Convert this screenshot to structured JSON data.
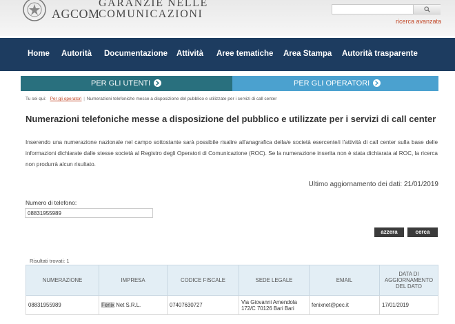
{
  "header": {
    "brand_line1": "GARANZIE NELLE",
    "brand_line2": "COMUNICAZIONI",
    "brand_acronym": "AGCOM",
    "search": {
      "placeholder": "",
      "button_icon": "search-icon"
    },
    "advanced_search": "ricerca avanzata"
  },
  "nav": {
    "items": [
      {
        "label": "Home"
      },
      {
        "label": "Autorità"
      },
      {
        "label": "Documentazione"
      },
      {
        "label": "Attività"
      },
      {
        "label": "Aree tematiche"
      },
      {
        "label": "Area Stampa"
      },
      {
        "label": "Autorità trasparente"
      }
    ]
  },
  "audience": {
    "users": "PER GLI UTENTI",
    "operators": "PER GLI OPERATORI"
  },
  "breadcrumb": {
    "prefix": "Tu sei qui:",
    "link": "Per gli operatori",
    "current": "Numerazioni telefoniche messe a disposizione del pubblico e utilizzate per i servizi di call center"
  },
  "page": {
    "title": "Numerazioni telefoniche messe a disposizione del pubblico e utilizzate per i servizi di call center",
    "description": "Inserendo una numerazione nazionale nel campo sottostante sarà possibile risalire all'anagrafica della/e società esercente/i l'attività di call center sulla base delle informazioni dichiarate dalle stesse società al Registro degli Operatori di Comunicazione (ROC). Se la numerazione inserita non è stata dichiarata al ROC, la ricerca non produrrà alcun risultato.",
    "last_update": "Ultimo aggiornamento dei dati: 21/01/2019"
  },
  "form": {
    "phone_label": "Numero di telefono:",
    "phone_value": "08831955989",
    "reset_label": "azzera",
    "search_label": "cerca"
  },
  "results": {
    "count_text": "Risultati trovati: 1",
    "columns": [
      "NUMERAZIONE",
      "IMPRESA",
      "CODICE FISCALE",
      "SEDE LEGALE",
      "EMAIL",
      "DATA DI AGGIORNAMENTO DEL DATO"
    ],
    "rows": [
      {
        "numerazione": "08831955989",
        "impresa_highlight": "Fenix",
        "impresa_rest": " Net S.R.L.",
        "codice_fiscale": "07407630727",
        "sede_legale": "Via Giovanni Amendola 172/C 70126 Bari Bari",
        "email": "fenixnet@pec.it",
        "data": "17/01/2019"
      }
    ]
  },
  "colors": {
    "nav_bg": "#1d3c60",
    "users_bg": "#29707e",
    "operators_bg": "#4ba1cf",
    "accent_link": "#c24a2a",
    "table_header_bg": "#e3eef5",
    "button_bg": "#3b3b3b"
  }
}
